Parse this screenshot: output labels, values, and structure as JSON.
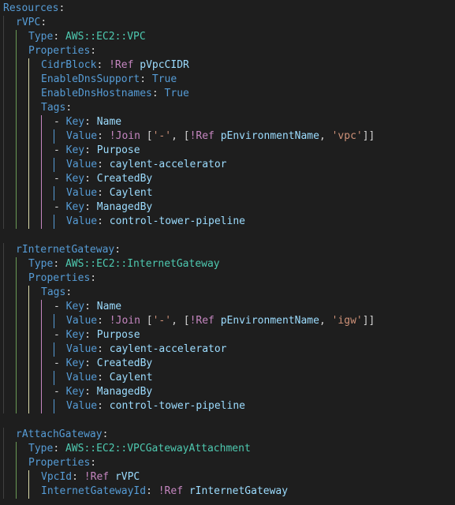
{
  "root_key": "Resources",
  "resources": {
    "rVPC": {
      "type": "AWS::EC2::VPC",
      "properties_key": "Properties",
      "cidr_key": "CidrBlock",
      "cidr_tag": "!Ref",
      "cidr_ref": "pVpcCIDR",
      "dns_support_key": "EnableDnsSupport",
      "dns_support_val": "True",
      "dns_host_key": "EnableDnsHostnames",
      "dns_host_val": "True",
      "tags_key": "Tags",
      "tags": [
        {
          "key_kw": "Key",
          "key": "Name",
          "val_kw": "Value",
          "val_tag": "!Join",
          "join_sep": "'-'",
          "ref_tag": "!Ref",
          "ref": "pEnvironmentName",
          "suffix": "'vpc'"
        },
        {
          "key_kw": "Key",
          "key": "Purpose",
          "val_kw": "Value",
          "val": "caylent-accelerator"
        },
        {
          "key_kw": "Key",
          "key": "CreatedBy",
          "val_kw": "Value",
          "val": "Caylent"
        },
        {
          "key_kw": "Key",
          "key": "ManagedBy",
          "val_kw": "Value",
          "val": "control-tower-pipeline"
        }
      ]
    },
    "rInternetGateway": {
      "type": "AWS::EC2::InternetGateway",
      "properties_key": "Properties",
      "tags_key": "Tags",
      "tags": [
        {
          "key_kw": "Key",
          "key": "Name",
          "val_kw": "Value",
          "val_tag": "!Join",
          "join_sep": "'-'",
          "ref_tag": "!Ref",
          "ref": "pEnvironmentName",
          "suffix": "'igw'"
        },
        {
          "key_kw": "Key",
          "key": "Purpose",
          "val_kw": "Value",
          "val": "caylent-accelerator"
        },
        {
          "key_kw": "Key",
          "key": "CreatedBy",
          "val_kw": "Value",
          "val": "Caylent"
        },
        {
          "key_kw": "Key",
          "key": "ManagedBy",
          "val_kw": "Value",
          "val": "control-tower-pipeline"
        }
      ]
    },
    "rAttachGateway": {
      "type": "AWS::EC2::VPCGatewayAttachment",
      "properties_key": "Properties",
      "vpcid_key": "VpcId",
      "vpcid_tag": "!Ref",
      "vpcid_ref": "rVPC",
      "igwid_key": "InternetGatewayId",
      "igwid_tag": "!Ref",
      "igwid_ref": "rInternetGateway"
    }
  },
  "labels": {
    "type_key": "Type",
    "rVPC": "rVPC",
    "rInternetGateway": "rInternetGateway",
    "rAttachGateway": "rAttachGateway"
  }
}
